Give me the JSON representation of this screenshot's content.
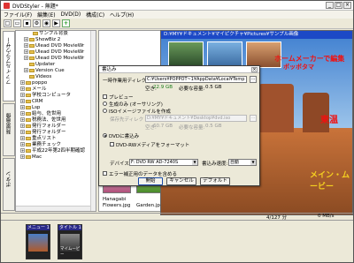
{
  "window": {
    "title": "DVDStyler - 無題*",
    "buttons": [
      "_",
      "□",
      "×"
    ]
  },
  "menubar": [
    "ファイル(F)",
    "編集(E)",
    "DVD(D)",
    "構成(C)",
    "ヘルプ(H)"
  ],
  "vertical_tabs": {
    "file_browser": "ファイルブラウザー",
    "backgrounds": "背景画像",
    "buttons": "ボタン"
  },
  "tree": [
    {
      "label": "サンプル背景",
      "indent": 3,
      "exp": "",
      "folder": true
    },
    {
      "label": "ShowBiz 2",
      "indent": 2,
      "exp": "+",
      "folder": true
    },
    {
      "label": "Ulead DVD MovieWr",
      "indent": 2,
      "exp": "+",
      "folder": true
    },
    {
      "label": "Ulead DVD MovieWr",
      "indent": 2,
      "exp": "+",
      "folder": true
    },
    {
      "label": "Ulead DVD MovieWr",
      "indent": 2,
      "exp": "+",
      "folder": true
    },
    {
      "label": "Updater",
      "indent": 2,
      "exp": "",
      "folder": true
    },
    {
      "label": "Version Cue",
      "indent": 2,
      "exp": "+",
      "folder": true
    },
    {
      "label": "Videos",
      "indent": 2,
      "exp": "",
      "folder": true
    },
    {
      "label": "poppo",
      "indent": 1,
      "exp": "+",
      "folder": true
    },
    {
      "label": "メール",
      "indent": 1,
      "exp": "+",
      "folder": true
    },
    {
      "label": "学校コンピュータ",
      "indent": 1,
      "exp": "+",
      "folder": true
    },
    {
      "label": "CRM",
      "indent": 1,
      "exp": "+",
      "folder": true
    },
    {
      "label": "Lsp",
      "indent": 1,
      "exp": "+",
      "folder": true
    },
    {
      "label": "給与、佐世用",
      "indent": 1,
      "exp": "+",
      "folder": true
    },
    {
      "label": "税務法、佐世用",
      "indent": 1,
      "exp": "+",
      "folder": true
    },
    {
      "label": "発行フォルダー",
      "indent": 1,
      "exp": "+",
      "folder": true
    },
    {
      "label": "発行フォルダー",
      "indent": 1,
      "exp": "+",
      "folder": true
    },
    {
      "label": "重点リスト",
      "indent": 1,
      "exp": "+",
      "folder": true
    },
    {
      "label": "業務チェック",
      "indent": 1,
      "exp": "+",
      "folder": true
    },
    {
      "label": "平成22年第2四半期確認",
      "indent": 1,
      "exp": "+",
      "folder": true
    },
    {
      "label": "Mac",
      "indent": 1,
      "exp": "+",
      "folder": true
    }
  ],
  "file_labels": {
    "file1": "Hanagabi",
    "file2": "Flowers.jpg",
    "file3": "Garden.jpg"
  },
  "preview": {
    "title_path": "D:¥MY¥ドキュメント¥マイピクチャ¥Pictures¥サンプル画像",
    "text_top": "ホームメーカーで編集",
    "text_top2": "ポッポタマ",
    "text_mid": "東温",
    "text_bottom": "メイン・ムービー"
  },
  "statusbar": {
    "size": "4/127 分",
    "free": "0 MB/s"
  },
  "menus": [
    {
      "label": "メニュー 1",
      "caption": ""
    },
    {
      "label": "タイトル 1",
      "caption": "マイムービー"
    }
  ],
  "dialog": {
    "title": "書込み",
    "temp_dir_label": "一時作業用ディレクトリ:",
    "temp_dir_value": "C:¥Users¥POPPOT~1¥AppData¥Local¥Temp",
    "free_space_label": "空き:",
    "free_space_value": "22.9 GB",
    "required_label": "必要な容量:",
    "required_value": "0.5 GB",
    "preview_label": "プレビュー",
    "only_generate_label": "生成のみ (オーサリング)",
    "iso_label": "ISOイメージファイルを作成",
    "save_to_label": "保存先ディレクトリ:",
    "save_to_value": "D:¥MY¥ドキュメント¥Desktop¥dvd.iso",
    "free2_label": "空き:",
    "free2_value": "60.7 GB",
    "required2_label": "必要な容量:",
    "required2_value": "0.5 GB",
    "burn_label": "DVDに書込み",
    "format_label": "DVD-RWメディアをフォーマット",
    "device_label": "デバイス:",
    "device_value": "F: DVD RW AD-7240S",
    "speed_label": "書込み速度:",
    "speed_value": "自動",
    "add_ecc_label": "エラー補正用のデータを含める",
    "start_button": "開始",
    "cancel_button": "キャンセル",
    "default_button": "デフォルト",
    "dots_label": "..."
  },
  "colors": {
    "preview_text": "#f01010",
    "free_space": "#1a7a1a",
    "title_bar": "#1c49c6"
  }
}
